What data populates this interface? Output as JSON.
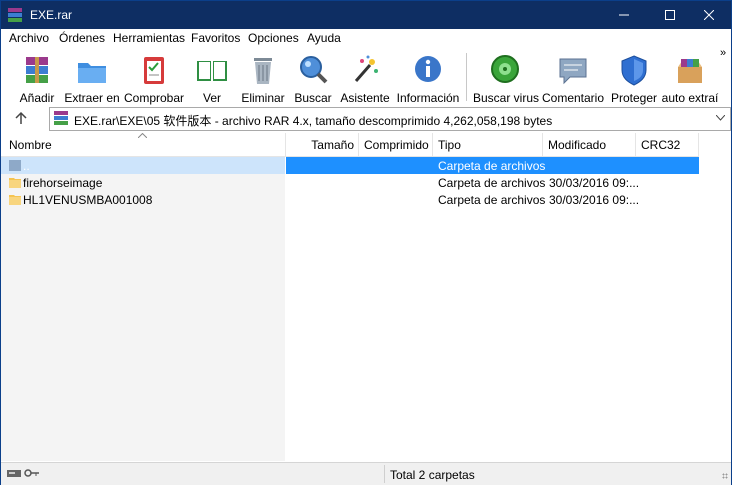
{
  "window": {
    "title": "EXE.rar"
  },
  "menu": [
    "Archivo",
    "Órdenes",
    "Herramientas",
    "Favoritos",
    "Opciones",
    "Ayuda"
  ],
  "toolbar": [
    {
      "label": "Añadir",
      "icon": "add-archive-icon"
    },
    {
      "label": "Extraer en",
      "icon": "extract-folder-icon"
    },
    {
      "label": "Comprobar",
      "icon": "test-clipboard-icon"
    },
    {
      "label": "Ver",
      "icon": "book-view-icon"
    },
    {
      "label": "Eliminar",
      "icon": "trash-icon"
    },
    {
      "label": "Buscar",
      "icon": "magnifier-icon"
    },
    {
      "label": "Asistente",
      "icon": "wand-icon"
    },
    {
      "label": "Información",
      "icon": "info-icon"
    },
    {
      "label": "Buscar virus",
      "icon": "virus-scan-icon"
    },
    {
      "label": "Comentario",
      "icon": "comment-icon"
    },
    {
      "label": "Proteger",
      "icon": "shield-icon"
    },
    {
      "label": "auto extraí",
      "icon": "sfx-box-icon"
    }
  ],
  "toolbar_overflow": "»",
  "address": {
    "path": "EXE.rar\\EXE\\05 软件版本 - archivo RAR 4.x, tamaño descomprimido 4,262,058,198 bytes"
  },
  "columns": [
    "Nombre",
    "Tamaño",
    "Comprimido",
    "Tipo",
    "Modificado",
    "CRC32"
  ],
  "rows": [
    {
      "name": "..",
      "size": "",
      "packed": "",
      "type": "Carpeta de archivos",
      "modified": "",
      "crc": "",
      "selected": true
    },
    {
      "name": "firehorseimage",
      "size": "",
      "packed": "",
      "type": "Carpeta de archivos",
      "modified": "30/03/2016 09:...",
      "crc": ""
    },
    {
      "name": "HL1VENUSMBA001008",
      "size": "",
      "packed": "",
      "type": "Carpeta de archivos",
      "modified": "30/03/2016 09:...",
      "crc": ""
    }
  ],
  "status": {
    "center": "Total 2 carpetas"
  },
  "colors": {
    "titlebar": "#0e2e63",
    "selection": "#1e90ff",
    "folder": "#f5c451"
  }
}
